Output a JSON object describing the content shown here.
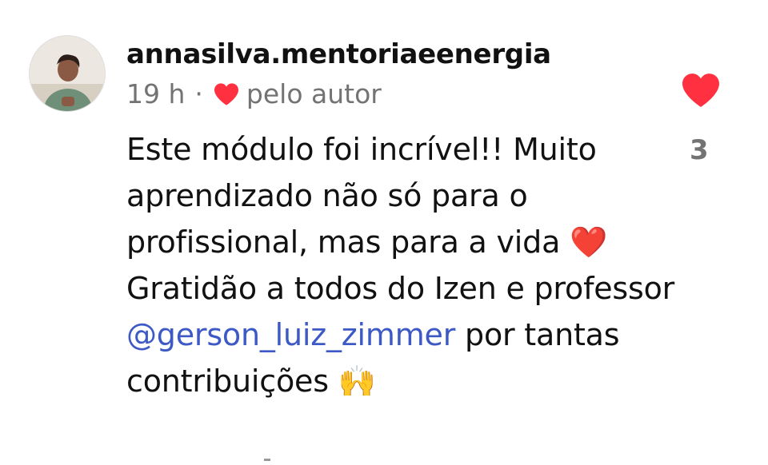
{
  "comment": {
    "username": "annasilva.mentoriaeenergia",
    "time": "19 h",
    "separator": "·",
    "liked_by_author_label": "pelo autor",
    "text_part1": "Este módulo foi incrível!! Muito aprendizado não só para o profissional, mas para a vida",
    "heart_emoji": "❤️",
    "text_part2": " Gratidão a todos do Izen e professor",
    "mention": "@gerson_luiz_zimmer",
    "text_part3": " por tantas contribuições",
    "raised_hands_emoji": "🙌",
    "like_count": "3"
  },
  "colors": {
    "heart_red": "#ff3040",
    "mention_blue": "#3d59c5",
    "meta_gray": "#737373"
  },
  "icons": {
    "like": "heart-icon",
    "liked_by_author": "heart-icon"
  }
}
